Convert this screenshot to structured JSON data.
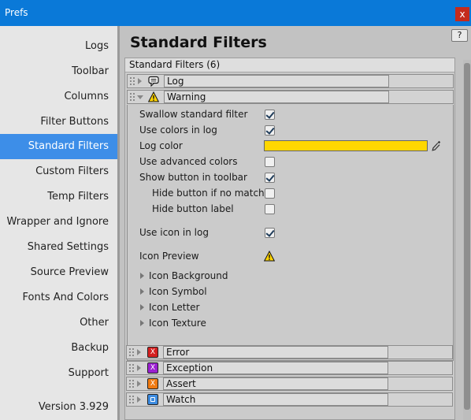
{
  "window": {
    "title": "Prefs",
    "close_label": "x"
  },
  "sidebar": {
    "items": [
      "Logs",
      "Toolbar",
      "Columns",
      "Filter Buttons",
      "Standard Filters",
      "Custom Filters",
      "Temp Filters",
      "Wrapper and Ignore",
      "Shared Settings",
      "Source Preview",
      "Fonts And Colors",
      "Other",
      "Backup",
      "Support"
    ],
    "active_index": 4,
    "version": "Version 3.929"
  },
  "main": {
    "title": "Standard Filters",
    "help_label": "?",
    "panel_header": "Standard Filters (6)",
    "filters": [
      {
        "name": "Log",
        "icon": "speech-bubble-icon",
        "expanded": false
      },
      {
        "name": "Warning",
        "icon": "warning-icon",
        "expanded": true
      },
      {
        "name": "Error",
        "icon": "error-icon",
        "icon_letter": "X",
        "color": "#d42020",
        "expanded": false
      },
      {
        "name": "Exception",
        "icon": "exception-icon",
        "icon_letter": "X",
        "color": "#9b1fd1",
        "expanded": false
      },
      {
        "name": "Assert",
        "icon": "assert-icon",
        "icon_letter": "X",
        "color": "#f07a12",
        "expanded": false
      },
      {
        "name": "Watch",
        "icon": "watch-icon",
        "icon_letter": "",
        "color": "#3c8be0",
        "expanded": false
      }
    ],
    "warning": {
      "swallow_label": "Swallow standard filter",
      "swallow": true,
      "use_colors_label": "Use colors in log",
      "use_colors": true,
      "log_color_label": "Log color",
      "log_color": "#ffd700",
      "advanced_label": "Use advanced colors",
      "advanced": false,
      "show_button_label": "Show button in toolbar",
      "show_button": true,
      "hide_if_no_match_label": "Hide button if no matche",
      "hide_if_no_match": false,
      "hide_label_label": "Hide button label",
      "hide_label": false,
      "use_icon_label": "Use icon in log",
      "use_icon": true,
      "icon_preview_label": "Icon Preview",
      "foldouts": [
        "Icon Background",
        "Icon Symbol",
        "Icon Letter",
        "Icon Texture"
      ]
    }
  }
}
